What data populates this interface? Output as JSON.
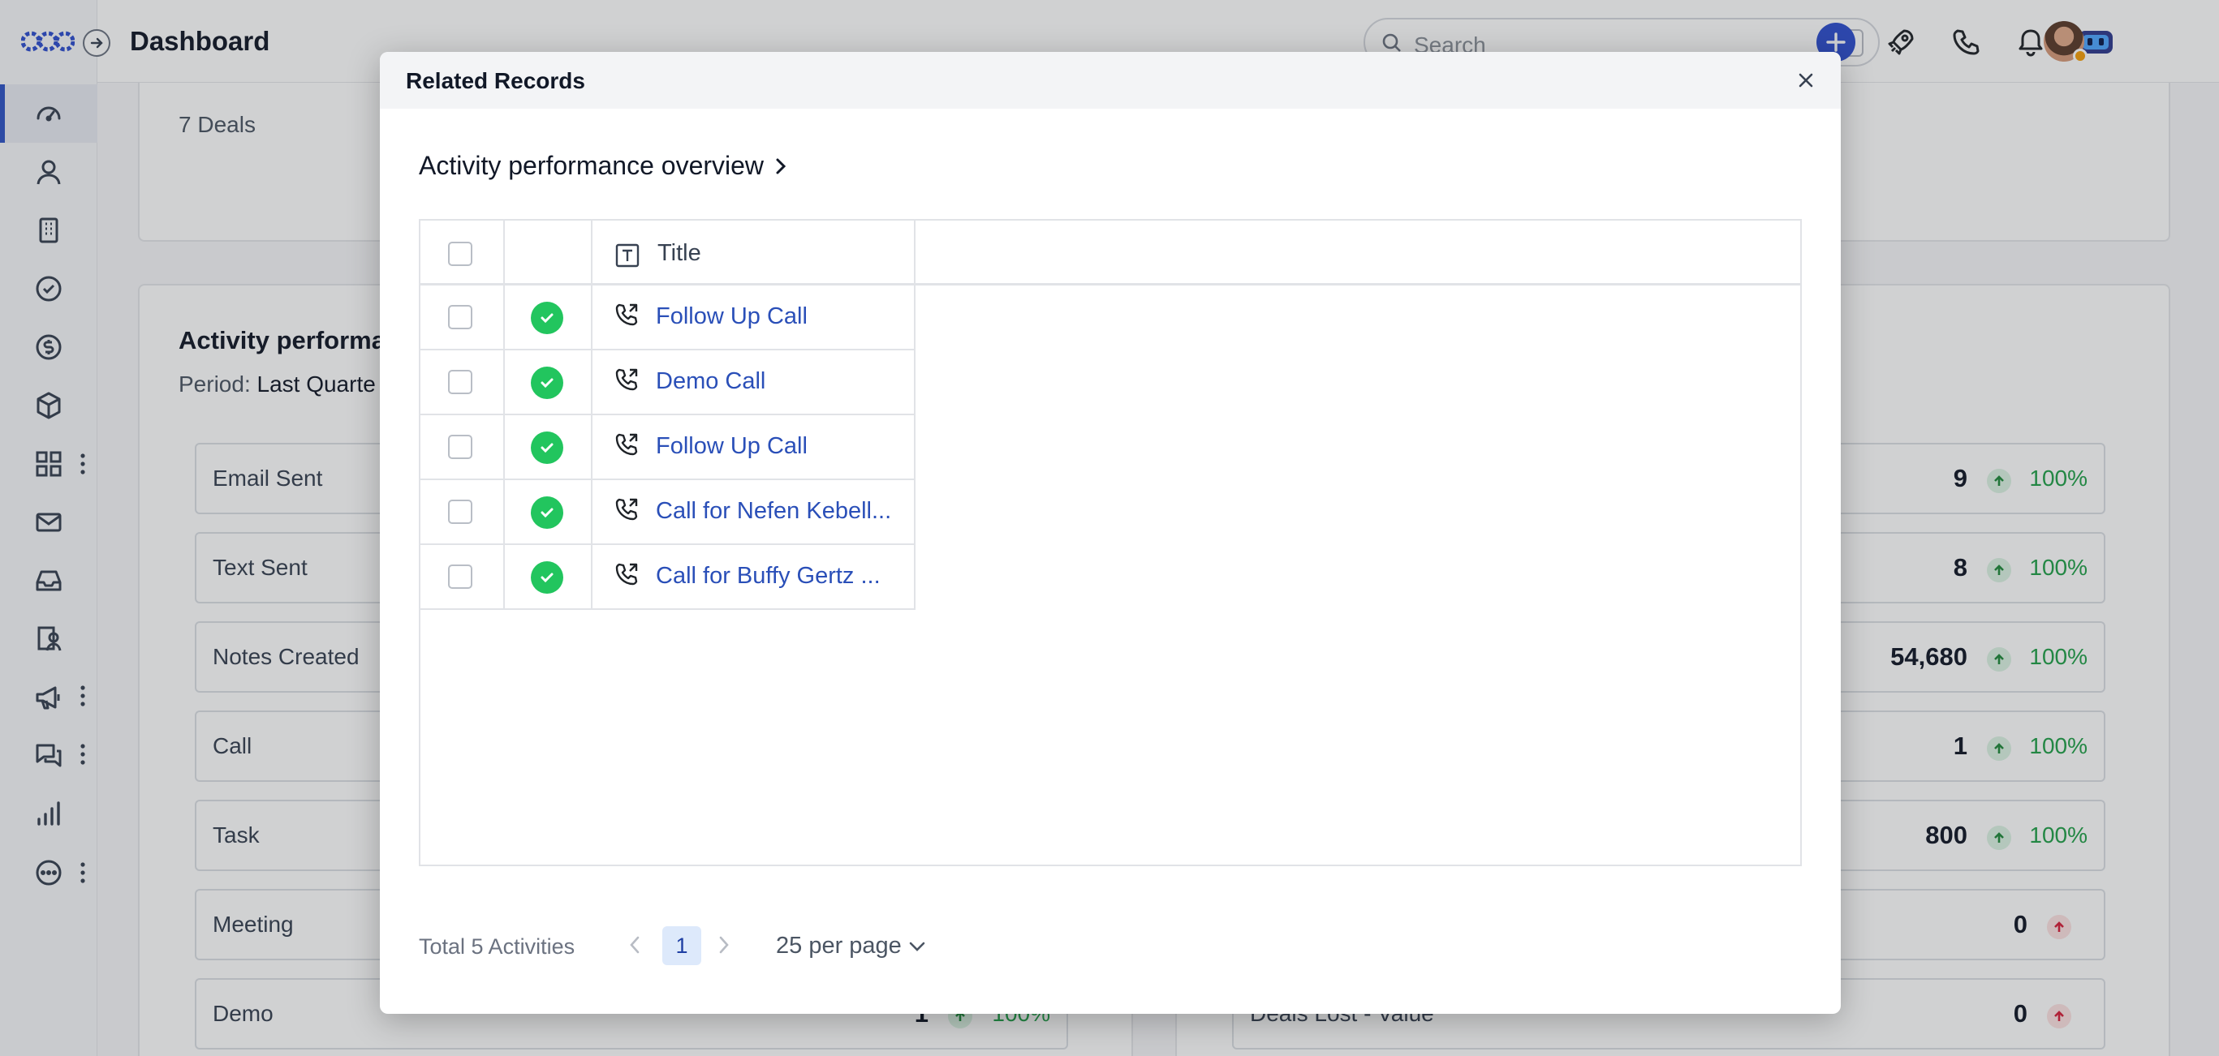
{
  "header": {
    "title": "Dashboard",
    "search_placeholder": "Search",
    "search_shortcut": "/"
  },
  "sidebar": {
    "items": [
      {
        "icon": "dashboard-gauge-icon",
        "active": true
      },
      {
        "icon": "person-icon"
      },
      {
        "icon": "building-icon"
      },
      {
        "icon": "check-circle-icon"
      },
      {
        "icon": "dollar-icon"
      },
      {
        "icon": "box-icon"
      },
      {
        "icon": "apps-grid-icon"
      },
      {
        "icon": "mail-icon"
      },
      {
        "icon": "inbox-icon"
      },
      {
        "icon": "chat-person-icon"
      },
      {
        "icon": "megaphone-icon"
      },
      {
        "icon": "chat-bubbles-icon"
      },
      {
        "icon": "bar-chart-icon"
      },
      {
        "icon": "more-circle-icon"
      }
    ]
  },
  "background": {
    "deals_count": "7 Deals",
    "activity_title": "Activity performa",
    "period_label": "Period:",
    "period_value": "Last Quarte",
    "left_metrics": [
      {
        "label": "Email Sent"
      },
      {
        "label": "Text Sent"
      },
      {
        "label": "Notes Created"
      },
      {
        "label": "Call"
      },
      {
        "label": "Task"
      },
      {
        "label": "Meeting"
      },
      {
        "label": "Demo",
        "value": "1",
        "pct": "100%"
      }
    ],
    "right_metrics": [
      {
        "value": "9",
        "pct": "100%",
        "trend": "up"
      },
      {
        "value": "8",
        "pct": "100%",
        "trend": "up"
      },
      {
        "value": "54,680",
        "pct": "100%",
        "trend": "up"
      },
      {
        "value": "1",
        "pct": "100%",
        "trend": "up"
      },
      {
        "value": "800",
        "pct": "100%",
        "trend": "up"
      },
      {
        "value": "0",
        "pct": "",
        "trend": "up-red"
      },
      {
        "label": "Deals Lost - Value",
        "value": "0",
        "pct": "",
        "trend": "up-red"
      }
    ]
  },
  "modal": {
    "title": "Related Records",
    "section_title": "Activity performance overview",
    "column_title": "Title",
    "rows": [
      {
        "title": "Follow Up Call"
      },
      {
        "title": "Demo Call"
      },
      {
        "title": "Follow Up Call"
      },
      {
        "title": "Call for Nefen Kebell..."
      },
      {
        "title": "Call for Buffy Gertz ..."
      }
    ],
    "footer": {
      "total": "Total 5 Activities",
      "page": "1",
      "per_page": "25 per page"
    }
  },
  "colors": {
    "accent": "#2f4fcf",
    "link": "#2a4fb8",
    "success": "#22c55e",
    "trend_green": "#22a04a"
  }
}
